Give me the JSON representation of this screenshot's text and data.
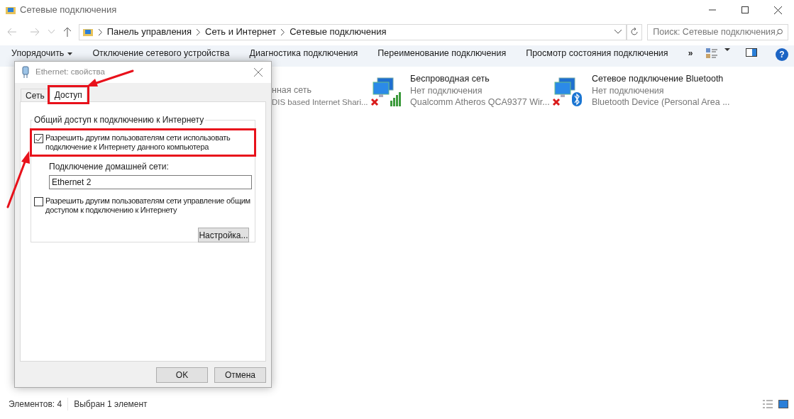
{
  "window": {
    "title": "Сетевые подключения"
  },
  "address_bar": {
    "breadcrumbs": [
      "Панель управления",
      "Сеть и Интернет",
      "Сетевые подключения"
    ]
  },
  "search": {
    "placeholder": "Поиск: Сетевые подключения"
  },
  "toolbar": {
    "items": [
      {
        "label": "Упорядочить",
        "dropdown": true
      },
      {
        "label": "Отключение сетевого устройства",
        "dropdown": false
      },
      {
        "label": "Диагностика подключения",
        "dropdown": false
      },
      {
        "label": "Переименование подключения",
        "dropdown": false
      },
      {
        "label": "Просмотр состояния подключения",
        "dropdown": false
      }
    ],
    "more": "»",
    "help": "?"
  },
  "connections": [
    {
      "kind": "covered",
      "status": "нная сеть",
      "device": "DIS based Internet Shari..."
    },
    {
      "kind": "wifi",
      "name": "Беспроводная сеть",
      "status": "Нет подключения",
      "device": "Qualcomm Atheros QCA9377 Wir..."
    },
    {
      "kind": "bluetooth",
      "name": "Сетевое подключение Bluetooth",
      "status": "Нет подключения",
      "device": "Bluetooth Device (Personal Area ..."
    }
  ],
  "status_bar": {
    "items": [
      "Элементов: 4",
      "Выбран 1 элемент"
    ]
  },
  "dialog": {
    "title": "Ethernet: свойства",
    "tabs": [
      {
        "label": "Сеть",
        "selected": false,
        "highlighted": false
      },
      {
        "label": "Доступ",
        "selected": true,
        "highlighted": true
      }
    ],
    "group_title": "Общий доступ к подключению к Интернету",
    "options": [
      {
        "kind": "checkbox",
        "label": "Разрешить другим пользователям сети использовать подключение к Интернету данного компьютера",
        "checked": true,
        "highlighted": true
      },
      {
        "kind": "field",
        "label": "Подключение домашней сети:",
        "value": "Ethernet 2"
      },
      {
        "kind": "checkbox",
        "label": "Разрешить другим пользователям сети управление общим доступом к подключению к Интернету",
        "checked": false,
        "highlighted": false
      },
      {
        "kind": "button",
        "label": "Настройка..."
      }
    ],
    "buttons": [
      "OK",
      "Отмена"
    ]
  }
}
